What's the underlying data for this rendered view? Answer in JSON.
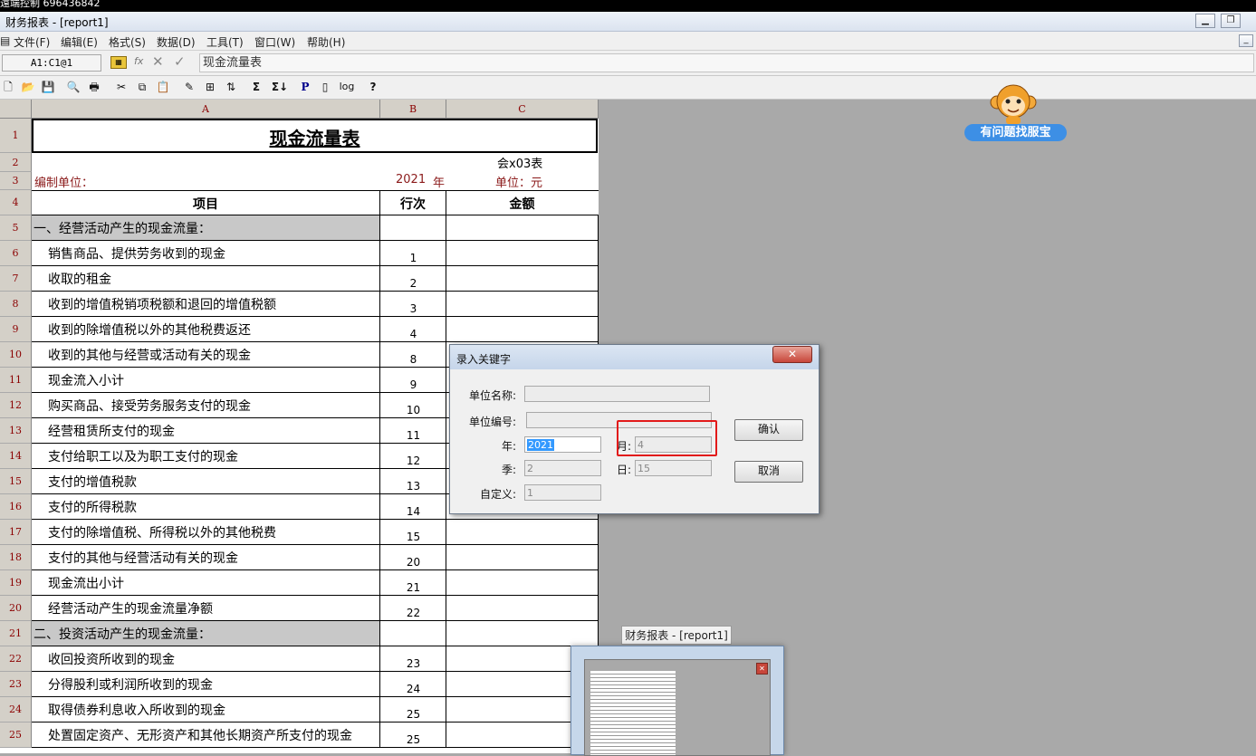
{
  "remote_bar": {
    "text": "遠端控制 696436842",
    "toggle": "⌄"
  },
  "window": {
    "title": "财务报表 - [report1]"
  },
  "menu": [
    "文件(F)",
    "编辑(E)",
    "格式(S)",
    "数据(D)",
    "工具(T)",
    "窗口(W)",
    "帮助(H)"
  ],
  "formula_bar": {
    "cell_ref": "A1:C1@1",
    "content": "现金流量表",
    "fx": "fx",
    "cancel": "✕",
    "accept": "✓"
  },
  "toolbar": {
    "sum": "Σ",
    "sum2": "Σ↓",
    "p": "P",
    "log": "log",
    "help": "?"
  },
  "sheet": {
    "columns": [
      "A",
      "B",
      "C"
    ],
    "title": "现金流量表",
    "form_code": "会x03表",
    "unit_label": "编制单位：",
    "year": "2021",
    "year_suffix": "年",
    "currency": "单位：元",
    "headers": {
      "item": "项目",
      "line": "行次",
      "amount": "金额"
    },
    "rows": [
      {
        "num": "5",
        "item": "一、经营活动产生的现金流量：",
        "line": "",
        "section": true
      },
      {
        "num": "6",
        "item": "销售商品、提供劳务收到的现金",
        "line": "1",
        "section": false
      },
      {
        "num": "7",
        "item": "收取的租金",
        "line": "2",
        "section": false
      },
      {
        "num": "8",
        "item": "收到的增值税销项税额和退回的增值税额",
        "line": "3",
        "section": false
      },
      {
        "num": "9",
        "item": "收到的除增值税以外的其他税费返还",
        "line": "4",
        "section": false
      },
      {
        "num": "10",
        "item": "收到的其他与经营或活动有关的现金",
        "line": "8",
        "section": false
      },
      {
        "num": "11",
        "item": "现金流入小计",
        "line": "9",
        "section": false
      },
      {
        "num": "12",
        "item": "购买商品、接受劳务服务支付的现金",
        "line": "10",
        "section": false
      },
      {
        "num": "13",
        "item": "经营租赁所支付的现金",
        "line": "11",
        "section": false
      },
      {
        "num": "14",
        "item": "支付给职工以及为职工支付的现金",
        "line": "12",
        "section": false
      },
      {
        "num": "15",
        "item": "支付的增值税款",
        "line": "13",
        "section": false
      },
      {
        "num": "16",
        "item": "支付的所得税款",
        "line": "14",
        "section": false
      },
      {
        "num": "17",
        "item": "支付的除增值税、所得税以外的其他税费",
        "line": "15",
        "section": false
      },
      {
        "num": "18",
        "item": "支付的其他与经营活动有关的现金",
        "line": "20",
        "section": false
      },
      {
        "num": "19",
        "item": "现金流出小计",
        "line": "21",
        "section": false
      },
      {
        "num": "20",
        "item": "经营活动产生的现金流量净额",
        "line": "22",
        "section": false
      },
      {
        "num": "21",
        "item": "二、投资活动产生的现金流量：",
        "line": "",
        "section": true
      },
      {
        "num": "22",
        "item": "收回投资所收到的现金",
        "line": "23",
        "section": false
      },
      {
        "num": "23",
        "item": "分得股利或利润所收到的现金",
        "line": "24",
        "section": false
      },
      {
        "num": "24",
        "item": "取得债券利息收入所收到的现金",
        "line": "25",
        "section": false
      },
      {
        "num": "25",
        "item": "处置固定资产、无形资产和其他长期资产所支付的现金",
        "line": "25",
        "section": false
      }
    ]
  },
  "dialog": {
    "title": "录入关键字",
    "close": "✕",
    "labels": {
      "unit_name": "单位名称:",
      "unit_code": "单位编号:",
      "year": "年:",
      "month": "月:",
      "quarter": "季:",
      "day": "日:",
      "custom": "自定义:"
    },
    "values": {
      "unit_name": "",
      "unit_code": "",
      "year": "2021",
      "month": "4",
      "quarter": "2",
      "day": "15",
      "custom": "1"
    },
    "ok": "确认",
    "cancel": "取消"
  },
  "helper": {
    "label": "有问题找服宝"
  },
  "taskbar_preview": {
    "title": "财务报表 - [report1]"
  },
  "colors": {
    "highlight": "#e21a1a",
    "row_header_text": "#8b0000",
    "dark_red_text": "#8b1a1a",
    "selection": "#3399ff",
    "helper_blue": "#3d8fe5"
  }
}
